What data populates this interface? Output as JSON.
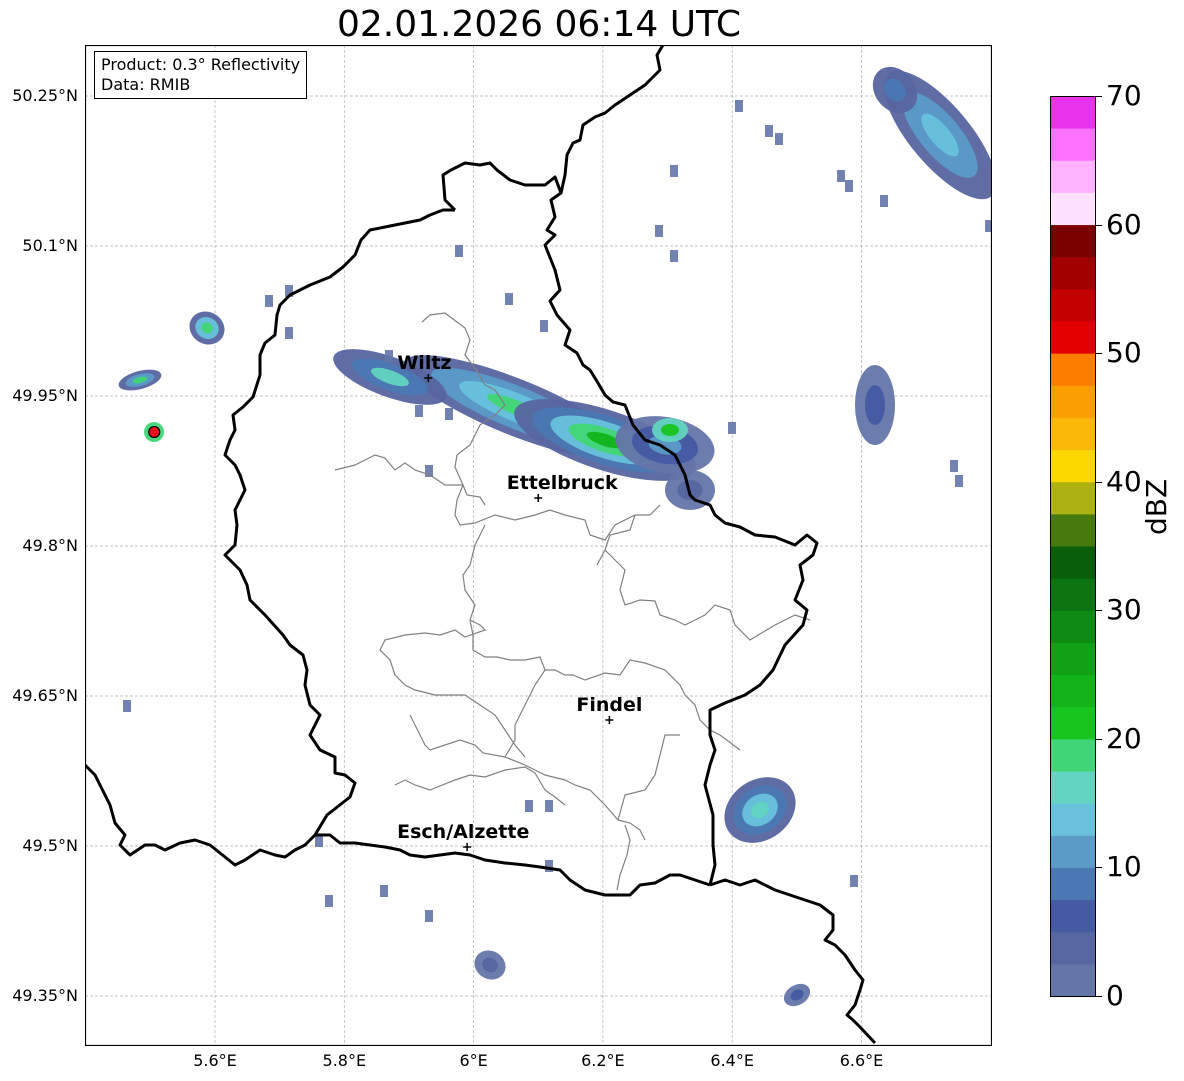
{
  "title": "02.01.2026 06:14 UTC",
  "info_box": {
    "line1": "Product: 0.3° Reflectivity",
    "line2": "Data: RMIB"
  },
  "axes": {
    "lat_ticks": [
      "50.25°N",
      "50.1°N",
      "49.95°N",
      "49.8°N",
      "49.65°N",
      "49.5°N",
      "49.35°N"
    ],
    "lon_ticks": [
      "5.6°E",
      "5.8°E",
      "6°E",
      "6.2°E",
      "6.4°E",
      "6.6°E"
    ],
    "lat_range": [
      49.3,
      50.3
    ],
    "lon_range": [
      5.4,
      6.8
    ]
  },
  "cities": [
    {
      "name": "Wiltz",
      "lon": 5.93,
      "lat": 49.968
    },
    {
      "name": "Ettelbruck",
      "lon": 6.1,
      "lat": 49.848
    },
    {
      "name": "Findel",
      "lon": 6.21,
      "lat": 49.626
    },
    {
      "name": "Esch/Alzette",
      "lon": 5.99,
      "lat": 49.499
    }
  ],
  "radar_site": {
    "lon": 5.506,
    "lat": 49.914,
    "color": "#e8101a"
  },
  "colorbar": {
    "label": "dBZ",
    "ticks": [
      "0",
      "10",
      "20",
      "30",
      "40",
      "50",
      "60",
      "70"
    ],
    "min": 0,
    "max": 70,
    "colors": [
      "#6475a8",
      "#5765a0",
      "#445aa2",
      "#4a78b2",
      "#5a9bc8",
      "#68c2dc",
      "#62d4c0",
      "#40d675",
      "#16c41e",
      "#12b41a",
      "#10a116",
      "#0f8a12",
      "#0c7410",
      "#095e0c",
      "#467a0c",
      "#adb210",
      "#fdd700",
      "#fcb808",
      "#fb9e00",
      "#fc7d00",
      "#e50000",
      "#c40000",
      "#a20000",
      "#7a0000",
      "#ffe0ff",
      "#ffb2ff",
      "#ff72ff",
      "#e733ea"
    ]
  },
  "colors": {
    "border_national": "#000000",
    "border_cantonal": "#808080",
    "grid": "#b0b0b0"
  }
}
